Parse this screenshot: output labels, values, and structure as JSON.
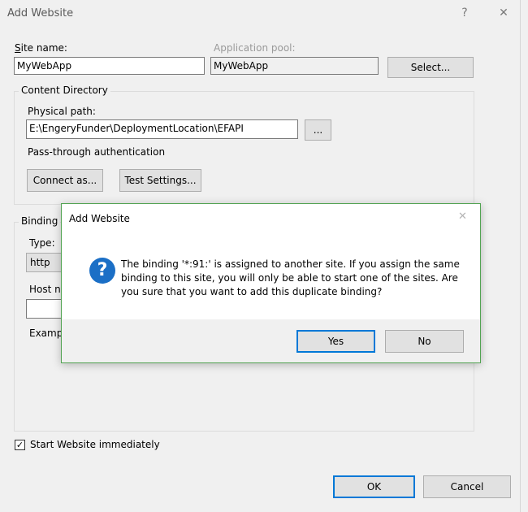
{
  "outer": {
    "title": "Add Website",
    "help_glyph": "?",
    "close_glyph": "✕",
    "site_name_label": "Site name:",
    "site_name_value": "MyWebApp",
    "app_pool_label": "Application pool:",
    "app_pool_value": "MyWebApp",
    "select_label": "Select...",
    "content_dir_title": "Content Directory",
    "physical_path_label": "Physical path:",
    "physical_path_value": "E:\\EngeryFunder\\DeploymentLocation\\EFAPI",
    "browse_label": "...",
    "pass_through_label": "Pass-through authentication",
    "connect_as_label": "Connect as...",
    "test_settings_label": "Test Settings...",
    "binding_title": "Binding",
    "type_label": "Type:",
    "type_value": "http",
    "host_name_label": "Host na",
    "host_name_value": "",
    "example_label": "Examp",
    "start_label": "Start Website immediately",
    "start_checked": true,
    "ok_label": "OK",
    "cancel_label": "Cancel"
  },
  "message_box": {
    "title": "Add Website",
    "close_glyph": "✕",
    "icon": "question-icon",
    "icon_glyph": "?",
    "message": "The binding '*:91:' is assigned to another site. If you assign the same binding to this site, you will only be able to start one of the sites. Are you sure that you want to add this duplicate binding?",
    "yes_label": "Yes",
    "no_label": "No"
  },
  "colors": {
    "accent": "#0078d7",
    "msgbox_border": "#52a352",
    "question_icon": "#1b6fc6"
  }
}
